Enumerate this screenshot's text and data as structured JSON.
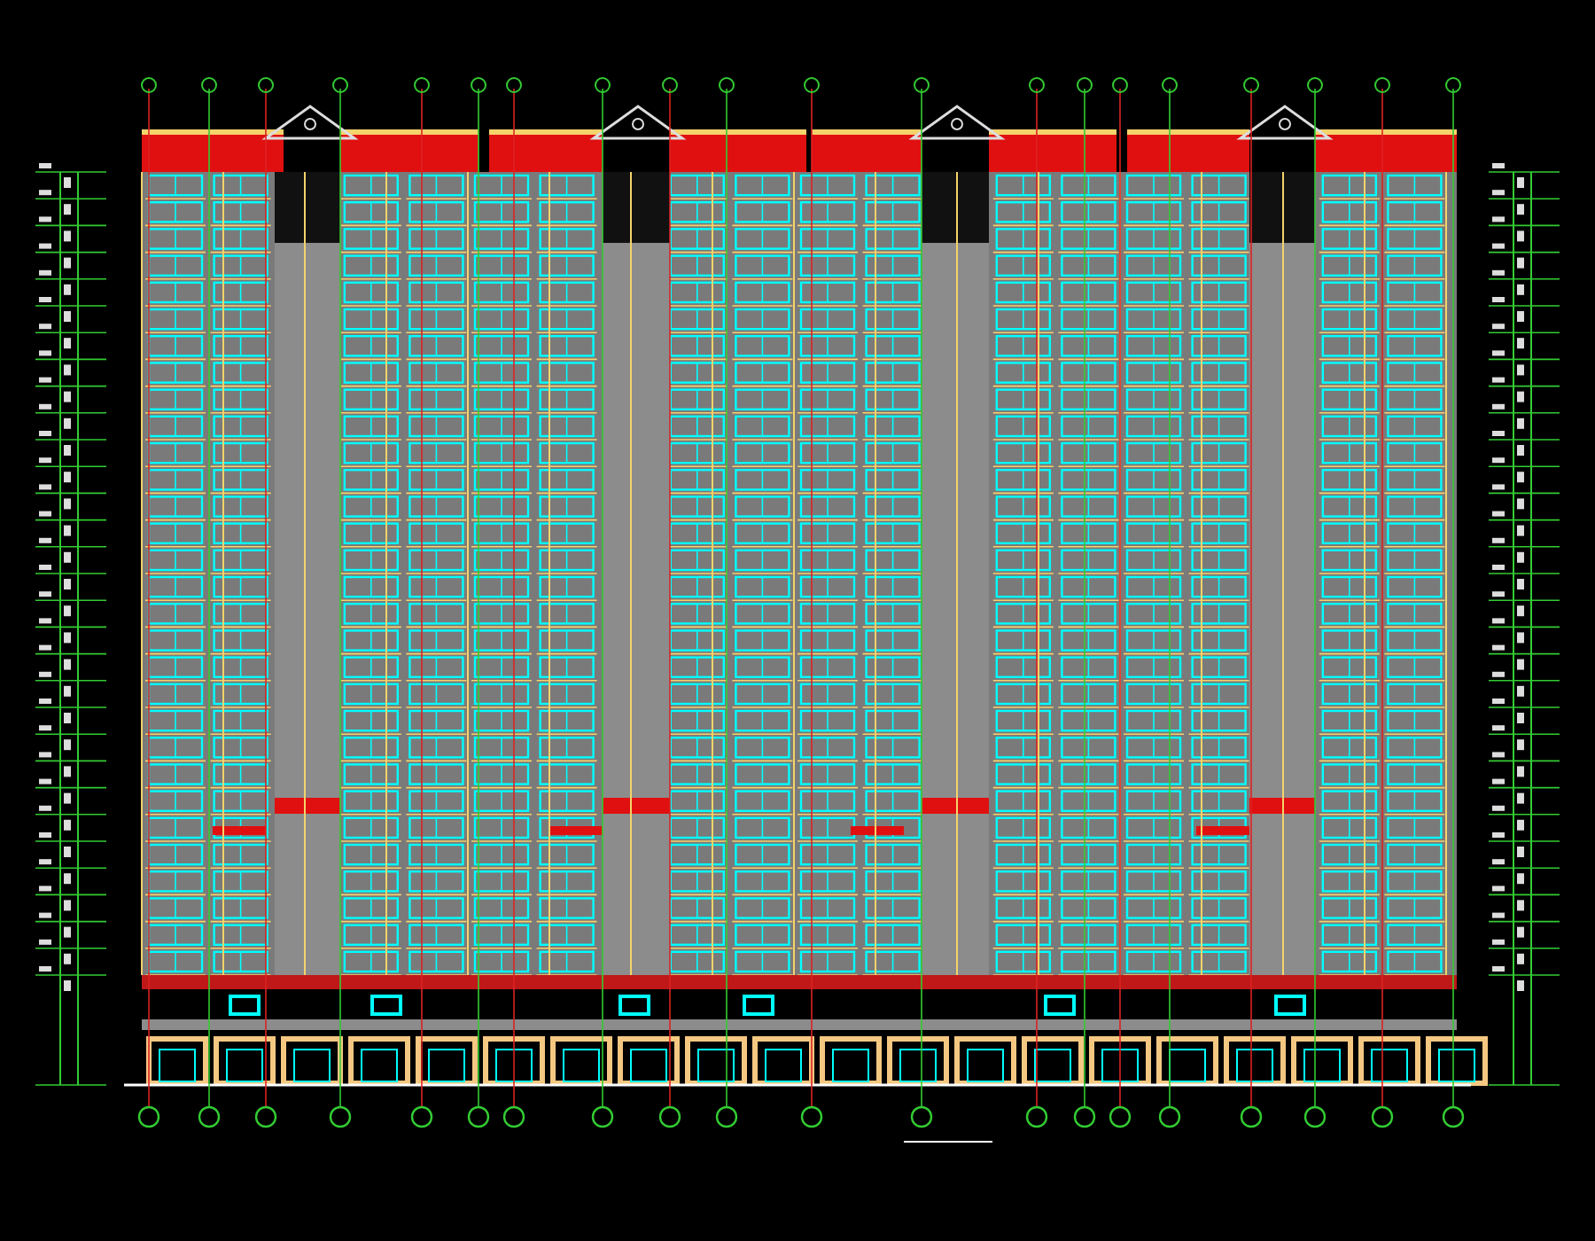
{
  "drawing": {
    "kind": "elevation"
  }
}
